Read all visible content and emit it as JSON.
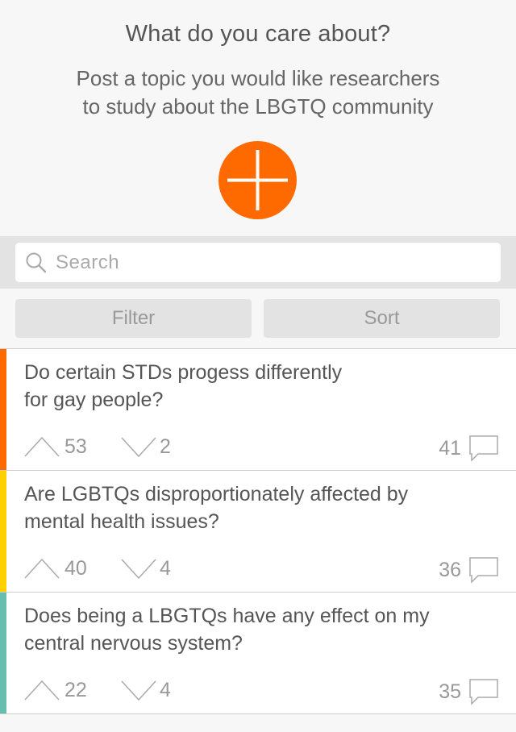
{
  "header": {
    "title": "What do you care about?",
    "subtitle_line1": "Post a topic you would like researchers",
    "subtitle_line2": "to study about the LBGTQ community",
    "add_button_color": "#ff6a00",
    "add_icon": "plus-icon"
  },
  "search": {
    "placeholder": "Search",
    "value": "",
    "icon": "search-icon"
  },
  "controls": {
    "filter_label": "Filter",
    "sort_label": "Sort"
  },
  "topics": [
    {
      "line1": "Do certain STDs progess differently",
      "line2": "for gay people?",
      "upvotes": "53",
      "downvotes": "2",
      "comments": "41",
      "accent": "#ff6a00"
    },
    {
      "line1": "Are LGBTQs disproportionately affected by",
      "line2": "mental health issues?",
      "upvotes": "40",
      "downvotes": "4",
      "comments": "36",
      "accent": "#ffd000"
    },
    {
      "line1": "Does being a LBGTQs have any effect on my",
      "line2": "central nervous system?",
      "upvotes": "22",
      "downvotes": "4",
      "comments": "35",
      "accent": "#66bfae"
    }
  ]
}
